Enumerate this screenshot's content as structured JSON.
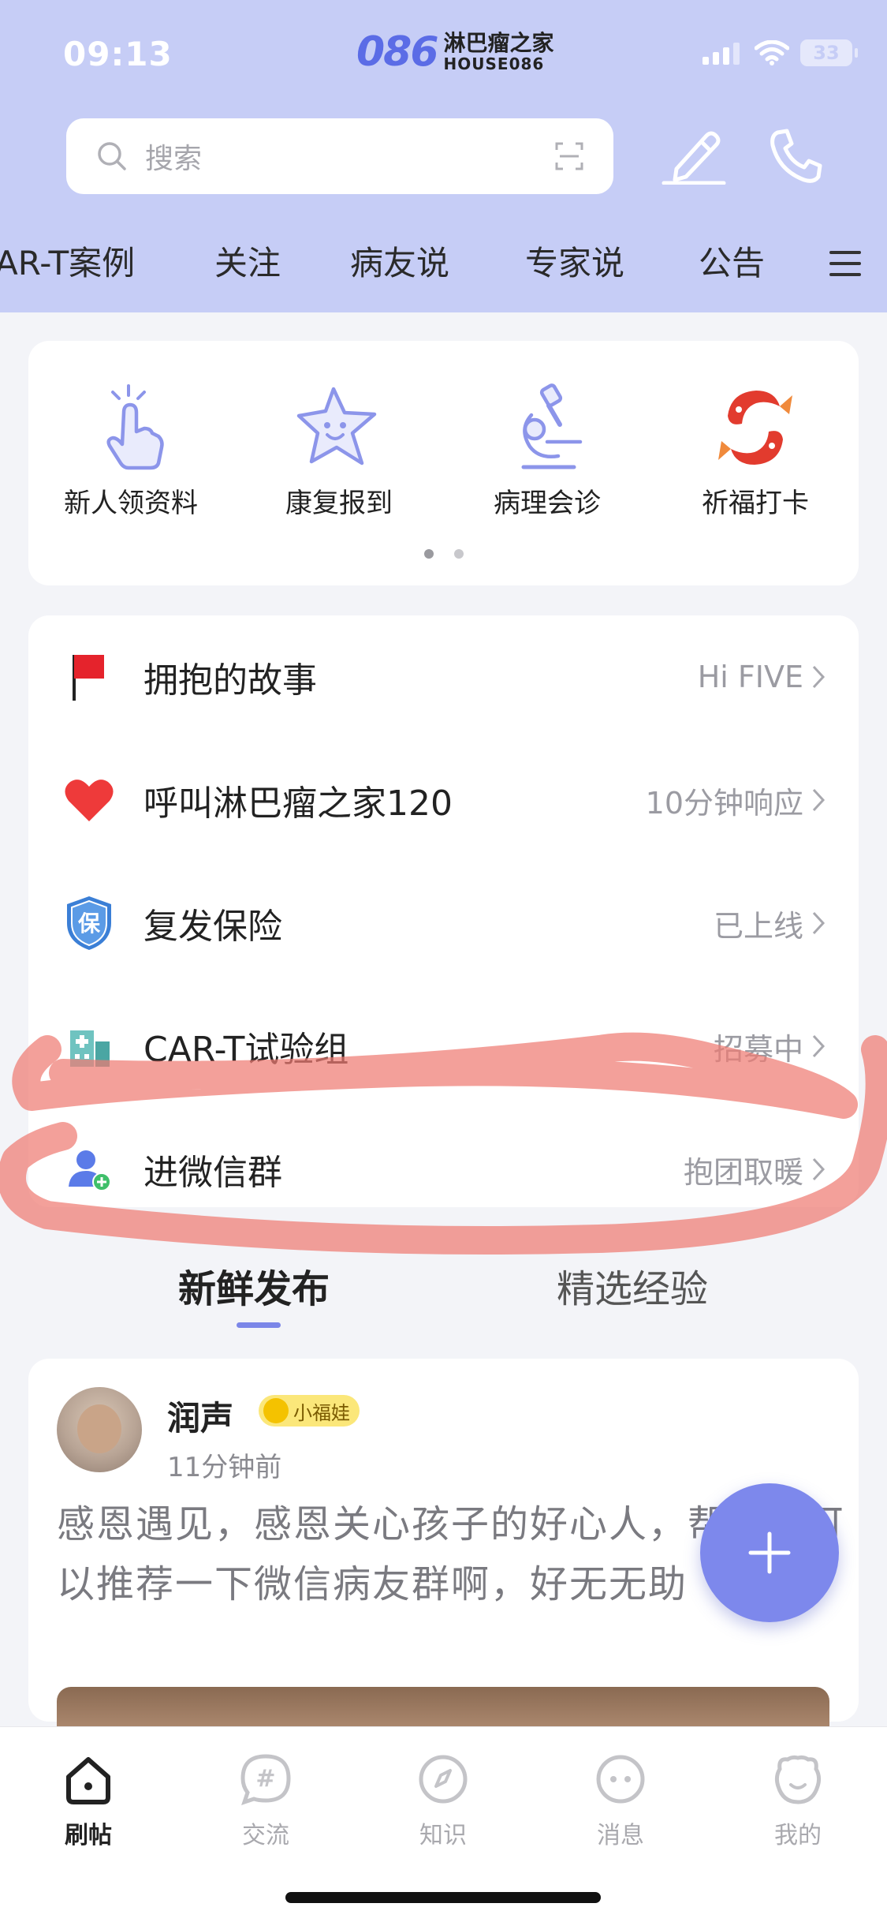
{
  "status": {
    "time": "09:13",
    "battery": "33"
  },
  "app": {
    "logo_mark": "086",
    "logo_cn": "淋巴瘤之家",
    "logo_en": "HOUSE086"
  },
  "search": {
    "placeholder": "搜索"
  },
  "tabs": [
    "AR-T案例",
    "关注",
    "病友说",
    "专家说",
    "公告"
  ],
  "quick_actions": [
    {
      "label": "新人领资料",
      "icon": "tap-hand-icon"
    },
    {
      "label": "康复报到",
      "icon": "star-smile-icon"
    },
    {
      "label": "病理会诊",
      "icon": "microscope-icon"
    },
    {
      "label": "祈福打卡",
      "icon": "koi-fish-icon"
    }
  ],
  "list": [
    {
      "title": "拥抱的故事",
      "right": "Hi FIVE",
      "icon": "red-flag-icon"
    },
    {
      "title": "呼叫淋巴瘤之家120",
      "right": "10分钟响应",
      "icon": "heart-icon"
    },
    {
      "title": "复发保险",
      "right": "已上线",
      "icon": "shield-icon",
      "icon_text": "保"
    },
    {
      "title": "CAR-T试验组",
      "right": "招募中",
      "icon": "hospital-icon"
    },
    {
      "title": "进微信群",
      "right": "抱团取暖",
      "icon": "add-user-icon"
    }
  ],
  "feed_tabs": {
    "active": "新鲜发布",
    "inactive": "精选经验"
  },
  "post": {
    "username": "润声",
    "badge": "小福娃",
    "time": "11分钟前",
    "text": "感恩遇见，感恩关心孩子的好心人，帮忙谁可以推荐一下微信病友群啊，好无无助"
  },
  "bottom_nav": [
    {
      "label": "刷帖",
      "active": true
    },
    {
      "label": "交流",
      "active": false
    },
    {
      "label": "知识",
      "active": false
    },
    {
      "label": "消息",
      "active": false
    },
    {
      "label": "我的",
      "active": false
    }
  ],
  "colors": {
    "header_bg": "#c6cdf6",
    "accent": "#7d88ec",
    "annotation": "#ee7b73"
  }
}
